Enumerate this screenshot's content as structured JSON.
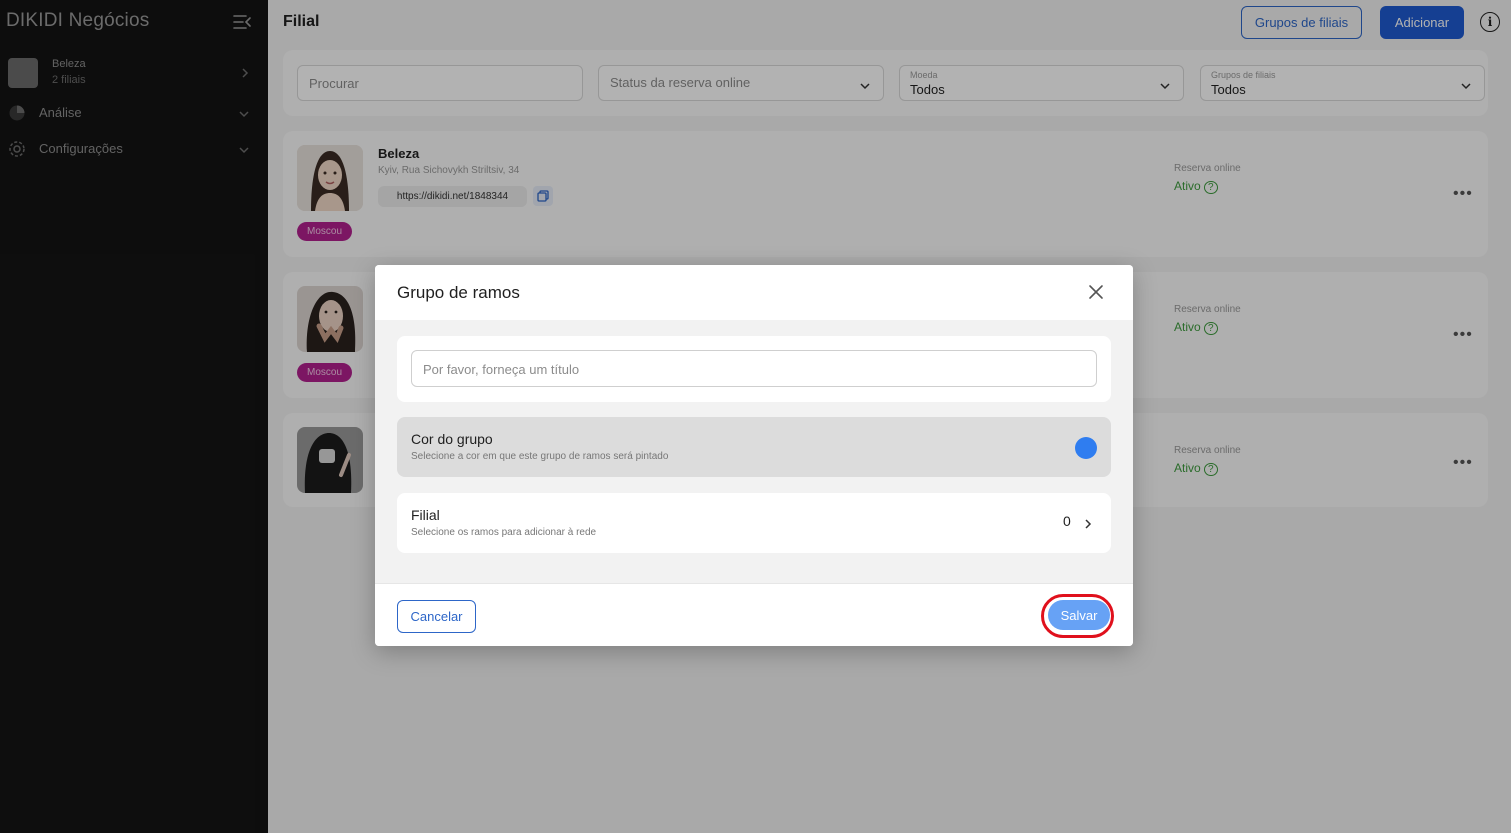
{
  "sidebar": {
    "brand": "DIKIDI Negócios",
    "account": {
      "name": "Beleza",
      "sub": "2 filiais"
    },
    "items": [
      {
        "label": "Análise",
        "icon": "pie-chart-icon"
      },
      {
        "label": "Configurações",
        "icon": "gear-icon"
      }
    ]
  },
  "header": {
    "title": "Filial",
    "groups_button": "Grupos de filiais",
    "add_button": "Adicionar"
  },
  "filters": {
    "search_placeholder": "Procurar",
    "status_placeholder": "Status da reserva online",
    "currency": {
      "label": "Moeda",
      "value": "Todos"
    },
    "groups": {
      "label": "Grupos de filiais",
      "value": "Todos"
    }
  },
  "branches": [
    {
      "name": "Beleza",
      "address": "Kyiv, Rua Sichovykh Striltsiv, 34",
      "link": "https://dikidi.net/1848344",
      "tag": "Moscou",
      "reservation_label": "Reserva online",
      "reservation_value": "Ativo"
    },
    {
      "tag": "Moscou",
      "reservation_label": "Reserva online",
      "reservation_value": "Ativo"
    },
    {
      "reservation_label": "Reserva online",
      "reservation_value": "Ativo"
    }
  ],
  "modal": {
    "title": "Grupo de ramos",
    "title_placeholder": "Por favor, forneça um título",
    "color": {
      "title": "Cor do grupo",
      "subtitle": "Selecione a cor em que este grupo de ramos será pintado",
      "value": "#2f7df0"
    },
    "branch": {
      "title": "Filial",
      "subtitle": "Selecione os ramos para adicionar à rede",
      "count": "0"
    },
    "cancel": "Cancelar",
    "save": "Salvar"
  },
  "colors": {
    "primary": "#1f5bd1",
    "save_button": "#67a2f5",
    "highlight": "#e0101c",
    "tag": "#b2208f",
    "active": "#3d9b3d"
  }
}
